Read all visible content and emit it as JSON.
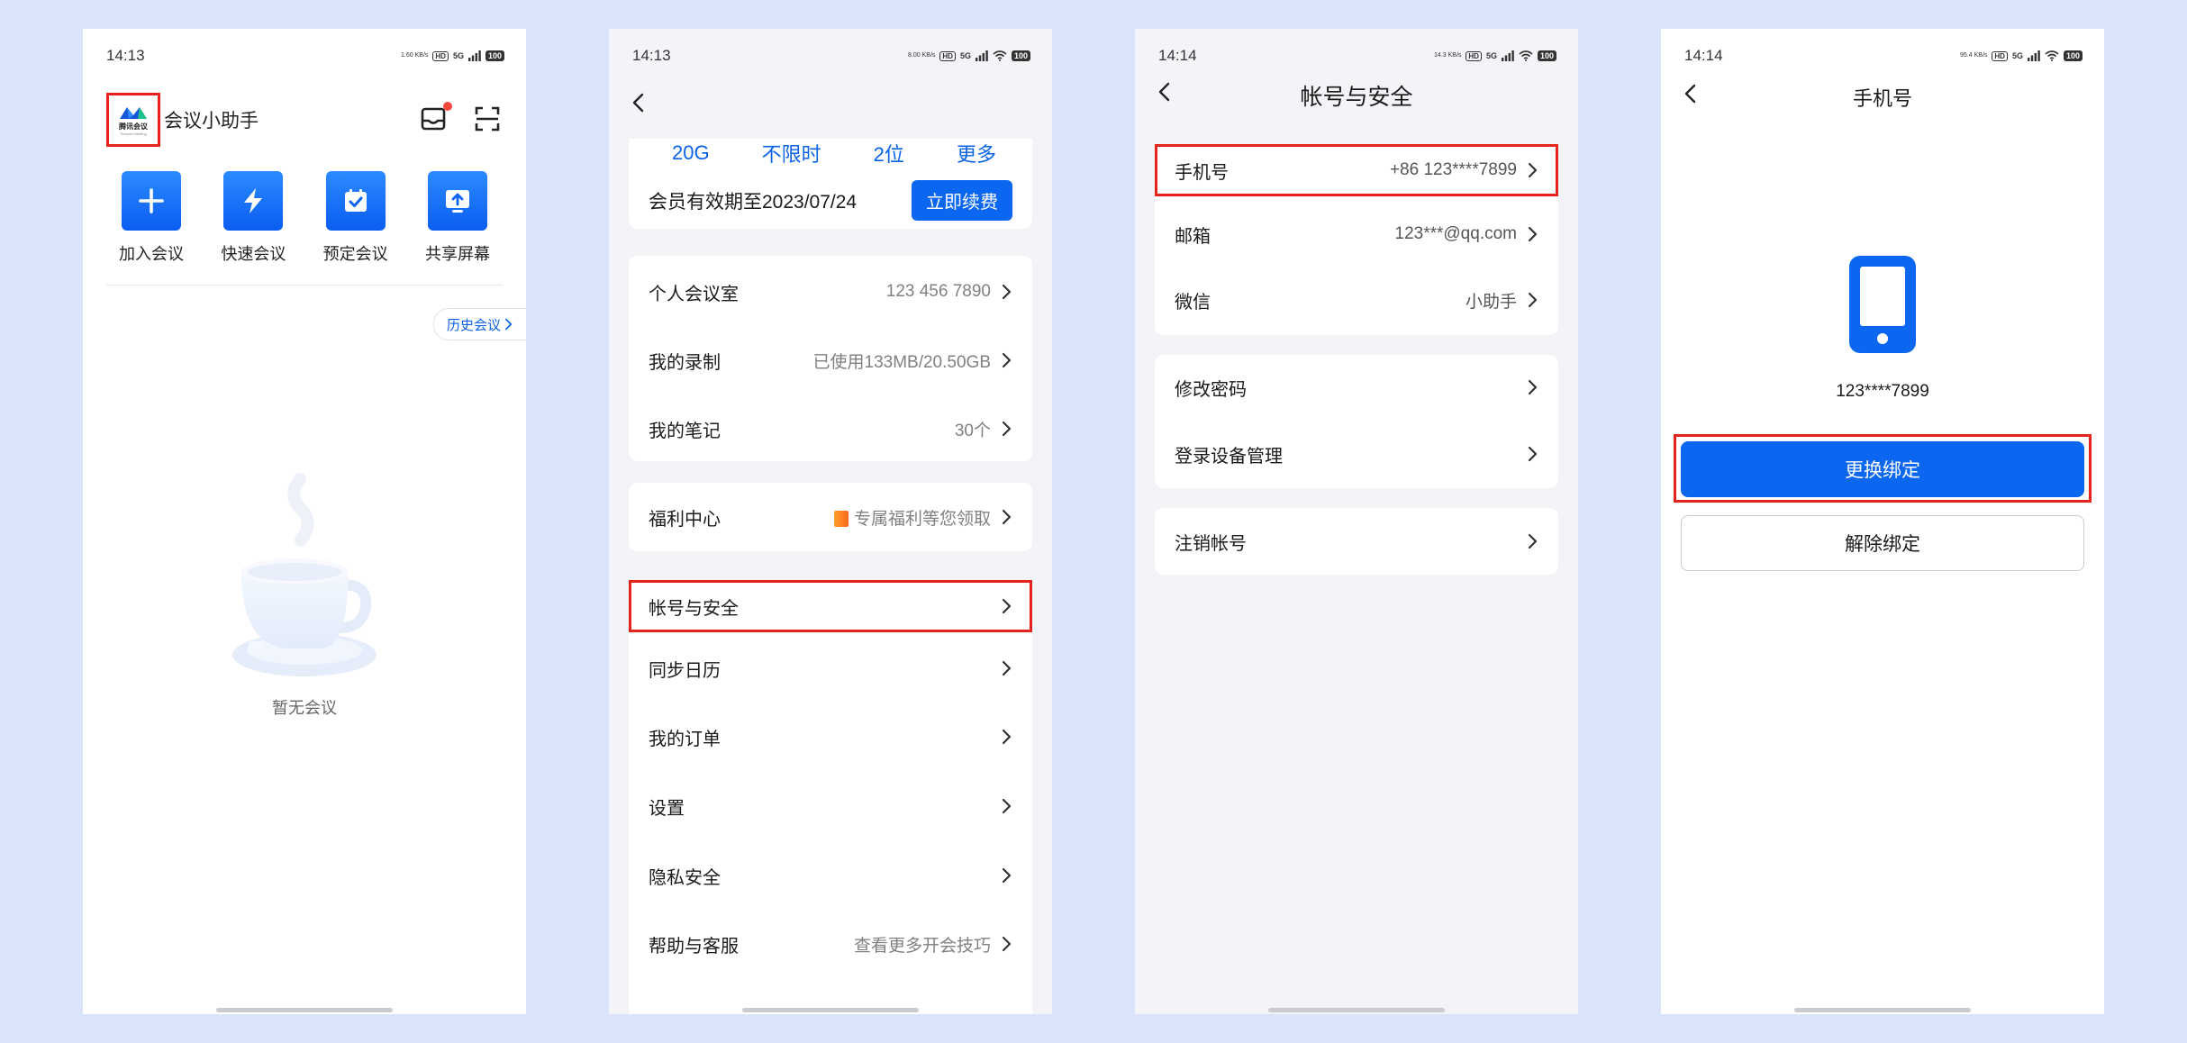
{
  "status": {
    "time1": "14:13",
    "time2": "14:13",
    "time3": "14:14",
    "time4": "14:14",
    "speed1": "1.60 KB/s",
    "speed2": "8.00 KB/s",
    "speed3": "14.3 KB/s",
    "speed4": "95.4 KB/s",
    "hd": "HD",
    "net": "5G",
    "battery": "100"
  },
  "screen1": {
    "logo_cn": "腾讯会议",
    "logo_en": "Tencent Meeting",
    "title": "会议小助手",
    "quick_actions": [
      {
        "label": "加入会议",
        "icon": "plus-icon"
      },
      {
        "label": "快速会议",
        "icon": "lightning-icon"
      },
      {
        "label": "预定会议",
        "icon": "calendar-check-icon"
      },
      {
        "label": "共享屏幕",
        "icon": "share-screen-icon"
      }
    ],
    "history_label": "历史会议",
    "empty_text": "暂无会议"
  },
  "screen2": {
    "vip_stats": [
      "20G",
      "不限时",
      "2位",
      "更多"
    ],
    "vip_expiry": "会员有效期至2023/07/24",
    "renew_label": "立即续费",
    "rows": [
      {
        "label": "个人会议室",
        "value": "123 456 7890"
      },
      {
        "label": "我的录制",
        "value": "已使用133MB/20.50GB"
      },
      {
        "label": "我的笔记",
        "value": "30个"
      },
      {
        "label": "福利中心",
        "value": "专属福利等您领取"
      },
      {
        "label": "帐号与安全",
        "value": ""
      },
      {
        "label": "同步日历",
        "value": ""
      },
      {
        "label": "我的订单",
        "value": ""
      },
      {
        "label": "设置",
        "value": ""
      },
      {
        "label": "隐私安全",
        "value": ""
      },
      {
        "label": "帮助与客服",
        "value": "查看更多开会技巧"
      }
    ]
  },
  "screen3": {
    "title": "帐号与安全",
    "rows": [
      {
        "label": "手机号",
        "value": "+86 123****7899"
      },
      {
        "label": "邮箱",
        "value": "123***@qq.com"
      },
      {
        "label": "微信",
        "value": "小助手"
      },
      {
        "label": "修改密码",
        "value": ""
      },
      {
        "label": "登录设备管理",
        "value": ""
      },
      {
        "label": "注销帐号",
        "value": ""
      }
    ]
  },
  "screen4": {
    "title": "手机号",
    "phone_number": "123****7899",
    "change_label": "更换绑定",
    "unbind_label": "解除绑定"
  },
  "colors": {
    "accent": "#0b66f0",
    "highlight": "#e5231c",
    "background": "#d9e4fb"
  }
}
